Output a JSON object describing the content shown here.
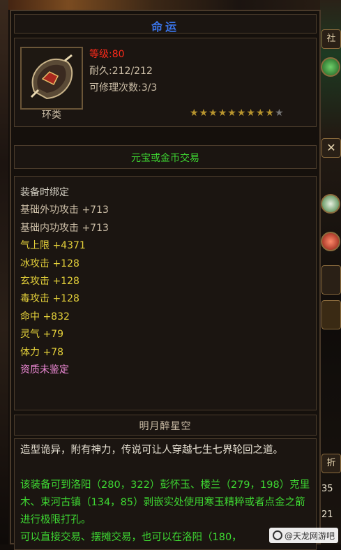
{
  "item": {
    "name": "命运",
    "level": "等级:80",
    "durability": "耐久:212/212",
    "repairs": "可修理次数:3/3",
    "type": "环类",
    "stars": {
      "filled": 9,
      "total": 10
    },
    "trade": "元宝或金币交易",
    "attributes": [
      {
        "text": "装备时绑定",
        "color": "#d8d4c8"
      },
      {
        "text": "基础外功攻击  +713",
        "color": "#cdbfa8"
      },
      {
        "text": "基础内功攻击  +713",
        "color": "#cdbfa8"
      },
      {
        "text": "气上限  +4371",
        "color": "#e6d23a"
      },
      {
        "text": "冰攻击  +128",
        "color": "#e6d23a"
      },
      {
        "text": "玄攻击  +128",
        "color": "#e6d23a"
      },
      {
        "text": "毒攻击  +128",
        "color": "#e6d23a"
      },
      {
        "text": "命中  +832",
        "color": "#e6d23a"
      },
      {
        "text": "灵气  +79",
        "color": "#e6d23a"
      },
      {
        "text": "体力  +78",
        "color": "#e6d23a"
      },
      {
        "text": "资质未鉴定",
        "color": "#f08ad8"
      }
    ],
    "set_name": "明月醉星空",
    "description_white": "造型诡异，附有神力，传说可让人穿越七生七界轮回之道。",
    "description_green": "该装备可到洛阳（280，322）彭怀玉、楼兰（279，198）克里木、束河古镇（134，85）剥嵌实处使用寒玉精粹或者点金之箭进行极限打孔。",
    "description_green2": "可以直接交易、摆摊交易，也可以在洛阳（180，"
  },
  "sidebar": {
    "buttons": [
      "社",
      "折"
    ],
    "numbers": [
      "35",
      "21"
    ]
  },
  "watermark": "@天龙网游吧",
  "colors": {
    "title": "#3a74e8",
    "level": "#ff2a1a",
    "green": "#3ed832",
    "star": "#b8952e"
  }
}
